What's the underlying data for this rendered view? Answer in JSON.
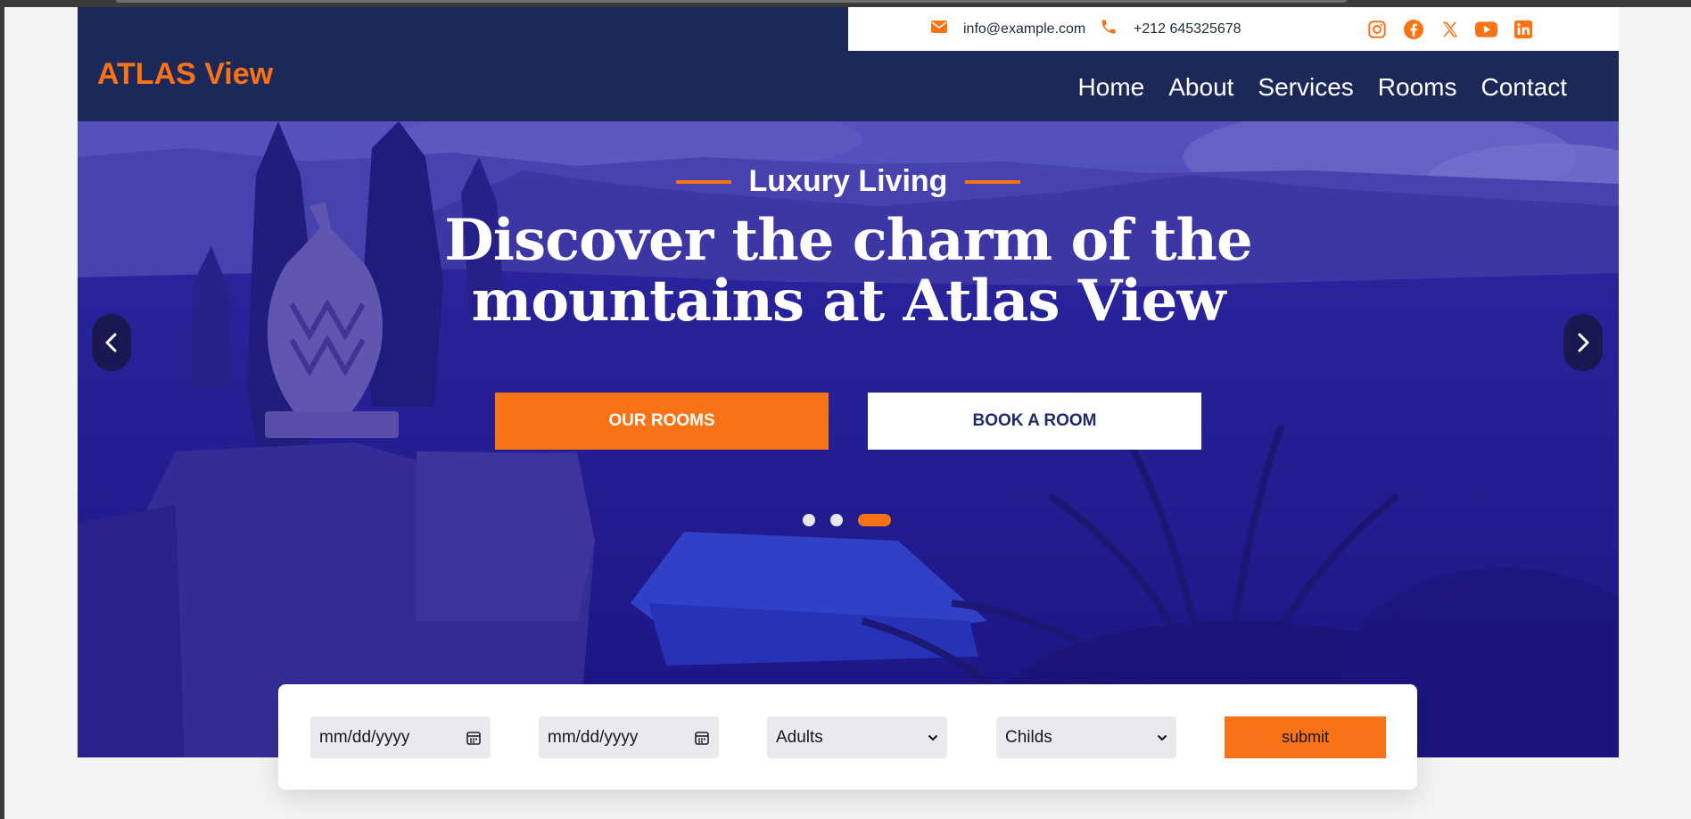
{
  "brand": {
    "name": "ATLAS View",
    "accent": "#f97316",
    "navy": "#1c2958"
  },
  "topbar": {
    "email": "info@example.com",
    "phone": "+212 645325678",
    "icons": [
      "envelope-icon",
      "phone-icon"
    ],
    "socials": [
      "instagram-icon",
      "facebook-icon",
      "x-icon",
      "youtube-icon",
      "linkedin-icon"
    ]
  },
  "nav": {
    "items": [
      "Home",
      "About",
      "Services",
      "Rooms",
      "Contact"
    ]
  },
  "hero": {
    "subtitle": "Luxury Living",
    "headline_line1": "Discover the charm of the",
    "headline_line2": "mountains at Atlas View",
    "btn_rooms": "OUR ROOMS",
    "btn_book": "BOOK A ROOM",
    "slides": 3,
    "active_slide": 3,
    "arrow_prev": "‹",
    "arrow_next": "›"
  },
  "booking": {
    "checkin_placeholder": "mm/dd/yyyy",
    "checkout_placeholder": "mm/dd/yyyy",
    "adults_label": "Adults",
    "childs_label": "Childs",
    "submit_label": "submit"
  }
}
